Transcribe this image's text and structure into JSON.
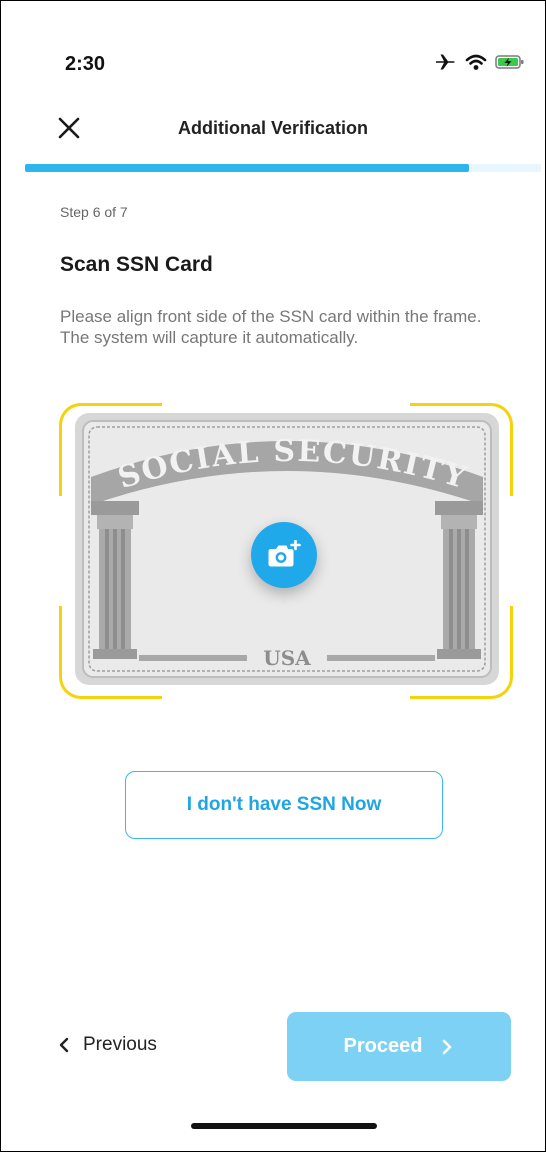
{
  "status_bar": {
    "time": "2:30",
    "icons": [
      "airplane-icon",
      "wifi-icon",
      "battery-charging-icon"
    ]
  },
  "header": {
    "title": "Additional Verification",
    "close_icon": "close-icon"
  },
  "progress": {
    "current_step": 6,
    "total_steps": 7,
    "fill_fraction": 0.86
  },
  "content": {
    "step_label": "Step 6 of 7",
    "title": "Scan SSN Card",
    "instructions": "Please align front side of the SSN card within the frame. The system will capture it automatically.",
    "card_heading": "SOCIAL SECURITY",
    "card_footer": "USA",
    "camera_icon": "camera-add-icon"
  },
  "actions": {
    "no_ssn_label": "I don't have SSN Now",
    "previous_label": "Previous",
    "proceed_label": "Proceed"
  },
  "colors": {
    "accent": "#2cb6ec",
    "scan_frame": "#f5d30c",
    "proceed_disabled": "#7dd1f5",
    "camera_button": "#1fa8ea"
  }
}
